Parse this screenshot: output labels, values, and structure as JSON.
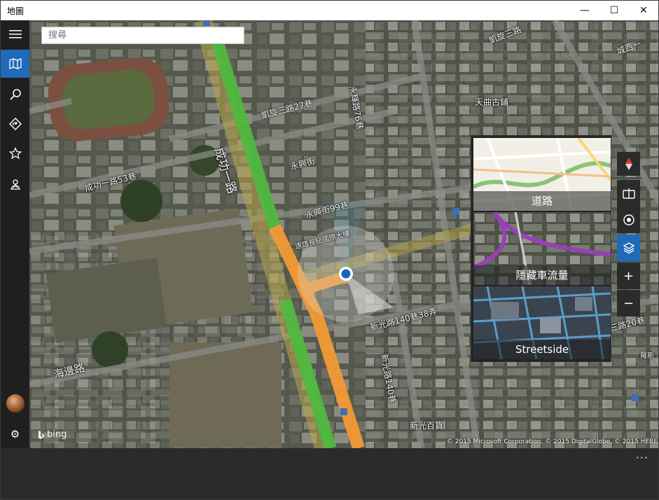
{
  "window": {
    "title": "地圖",
    "minimize_glyph": "—",
    "maximize_glyph": "☐",
    "close_glyph": "✕"
  },
  "sidebar": {
    "items": [
      {
        "name": "hamburger-menu-icon",
        "glyph": "☰"
      },
      {
        "name": "map-icon",
        "glyph": "🗺",
        "active": true
      },
      {
        "name": "search-icon",
        "glyph": "⚲"
      },
      {
        "name": "directions-icon",
        "glyph": "⮞"
      },
      {
        "name": "favorites-icon",
        "glyph": "☆"
      },
      {
        "name": "cities-icon",
        "glyph": "⛶"
      }
    ],
    "settings_glyph": "⚙"
  },
  "search": {
    "placeholder": "搜尋"
  },
  "map": {
    "labels": {
      "road_chenggong": "成功一路",
      "road_chenggong_53": "成功一路53巷",
      "road_yongxing": "永興街",
      "road_yongxing_99": "永興街99巷",
      "road_kaixuan_27": "凱旋三路27巷",
      "road_yonghui_76": "永輝路76巷",
      "road_xinguang_140_38": "新光路140巷38弄",
      "road_xinguang_140": "新光路140巷",
      "road_haibian": "海邊路",
      "road_sanduo_20": "三路20巷",
      "road_kaixuan_top": "凱旋三路",
      "road_chengxi": "城西一",
      "building_dasheng": "遠雄長紐國際大樓",
      "poi_restaurant": "天曲古鋪",
      "poi_xinguang": "新光百貨",
      "poi_luomi": "羅斯"
    },
    "bing_logo": "bing",
    "copyright": "© 2015 Microsoft Corporation, © 2015 DigitalGlobe, © 2015 HERE"
  },
  "map_styles": {
    "tiles": [
      {
        "label": "道路"
      },
      {
        "label": "隱藏車流量"
      },
      {
        "label": "Streetside"
      }
    ]
  },
  "map_controls": {
    "compass_glyph": "▲",
    "streetside_glyph": "⿻",
    "locate_glyph": "◉",
    "layers_glyph": "◈",
    "zoom_in_glyph": "+",
    "zoom_out_glyph": "−"
  },
  "bottom": {
    "more_glyph": "···"
  },
  "colors": {
    "accent": "#1f6ab9",
    "traffic_green": "#4fb83f",
    "traffic_orange": "#f39a35",
    "location_blue": "#1565c0"
  }
}
